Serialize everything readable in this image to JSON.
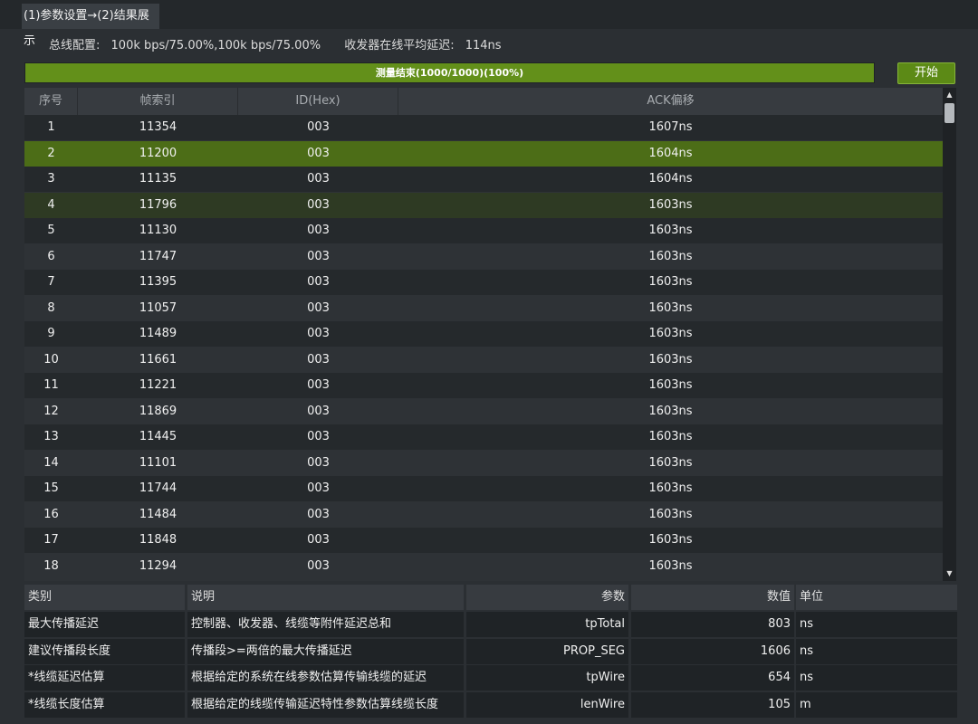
{
  "tab": {
    "label": "(1)参数设置→(2)结果展示"
  },
  "info": {
    "bus_config_label": "总线配置:",
    "bus_config_value": "100k bps/75.00%,100k bps/75.00%",
    "avg_delay_label": "收发器在线平均延迟:",
    "avg_delay_value": "114ns"
  },
  "progress": {
    "text": "测量结束(1000/1000)(100%)",
    "fraction": 1.0
  },
  "start_button": {
    "label": "开始"
  },
  "colors": {
    "accent": "#63901a",
    "selected_row": "#4c6d17",
    "highlight_row": "#2e3a23"
  },
  "table": {
    "headers": [
      "序号",
      "帧索引",
      "ID(Hex)",
      "ACK偏移"
    ],
    "rows": [
      [
        "1",
        "11354",
        "003",
        "1607ns"
      ],
      [
        "2",
        "11200",
        "003",
        "1604ns"
      ],
      [
        "3",
        "11135",
        "003",
        "1604ns"
      ],
      [
        "4",
        "11796",
        "003",
        "1603ns"
      ],
      [
        "5",
        "11130",
        "003",
        "1603ns"
      ],
      [
        "6",
        "11747",
        "003",
        "1603ns"
      ],
      [
        "7",
        "11395",
        "003",
        "1603ns"
      ],
      [
        "8",
        "11057",
        "003",
        "1603ns"
      ],
      [
        "9",
        "11489",
        "003",
        "1603ns"
      ],
      [
        "10",
        "11661",
        "003",
        "1603ns"
      ],
      [
        "11",
        "11221",
        "003",
        "1603ns"
      ],
      [
        "12",
        "11869",
        "003",
        "1603ns"
      ],
      [
        "13",
        "11445",
        "003",
        "1603ns"
      ],
      [
        "14",
        "11101",
        "003",
        "1603ns"
      ],
      [
        "15",
        "11744",
        "003",
        "1603ns"
      ],
      [
        "16",
        "11484",
        "003",
        "1603ns"
      ],
      [
        "17",
        "11848",
        "003",
        "1603ns"
      ],
      [
        "18",
        "11294",
        "003",
        "1603ns"
      ]
    ],
    "selected_row": 2,
    "highlighted_row": 4
  },
  "stats": {
    "headers": [
      "类别",
      "说明",
      "参数",
      "数值",
      "单位"
    ],
    "rows": [
      [
        "最大传播延迟",
        "控制器、收发器、线缆等附件延迟总和",
        "tpTotal",
        "803",
        "ns"
      ],
      [
        "建议传播段长度",
        "传播段>=两倍的最大传播延迟",
        "PROP_SEG",
        "1606",
        "ns"
      ],
      [
        "*线缆延迟估算",
        "根据给定的系统在线参数估算传输线缆的延迟",
        "tpWire",
        "654",
        "ns"
      ],
      [
        "*线缆长度估算",
        "根据给定的线缆传输延迟特性参数估算线缆长度",
        "lenWire",
        "105",
        "m"
      ]
    ]
  }
}
